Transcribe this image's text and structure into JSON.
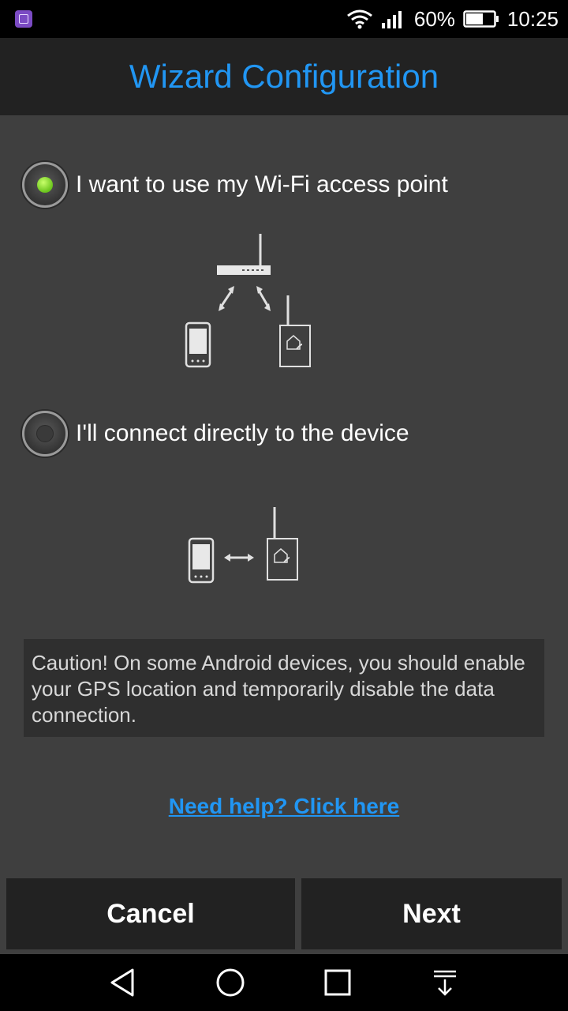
{
  "status_bar": {
    "battery_percent": "60%",
    "time": "10:25",
    "icons": [
      "gallery-icon",
      "wifi-icon",
      "signal-icon",
      "battery-icon"
    ]
  },
  "header": {
    "title": "Wizard Configuration"
  },
  "options": [
    {
      "label": "I want to use my Wi-Fi access point",
      "selected": true
    },
    {
      "label": "I'll connect directly to the device",
      "selected": false
    }
  ],
  "caution": "Caution! On some Android devices, you should enable your GPS location and temporarily disable the data connection.",
  "help_link": "Need help? Click here",
  "buttons": {
    "cancel": "Cancel",
    "next": "Next"
  },
  "nav": [
    "back-icon",
    "home-icon",
    "recents-icon",
    "notification-pull-icon"
  ],
  "colors": {
    "accent": "#2196f3",
    "radio_selected": "#7ed321",
    "background": "#3f3f3f",
    "bar": "#222222"
  }
}
